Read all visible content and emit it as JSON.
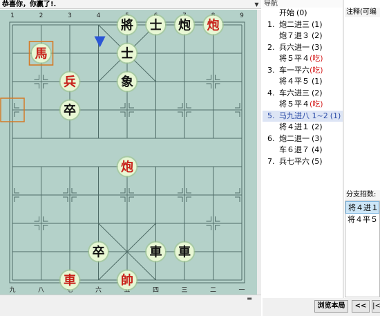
{
  "board": {
    "title": "恭喜你，你赢了!.",
    "dropdown_icon": "▼",
    "top_coords": [
      "1",
      "2",
      "3",
      "4",
      "5",
      "6",
      "7",
      "8",
      "9"
    ],
    "bottom_coords": [
      "九",
      "八",
      "七",
      "六",
      "五",
      "四",
      "三",
      "二",
      "一"
    ],
    "colors": {
      "board_bg": "#b4d1c9",
      "grid_line": "#4e6b66",
      "red_text": "#c8201a",
      "black_text": "#111111",
      "piece_fill": "#e8f7d4",
      "piece_ring": "#9ec48d",
      "marker_orange": "#d47a27",
      "arrow_blue": "#2b56d6"
    },
    "pieces": [
      {
        "char": "將",
        "side": "black",
        "file": 4,
        "rank": 0
      },
      {
        "char": "士",
        "side": "black",
        "file": 5,
        "rank": 0
      },
      {
        "char": "炮",
        "side": "black",
        "file": 6,
        "rank": 0
      },
      {
        "char": "炮",
        "side": "red",
        "file": 7,
        "rank": 0
      },
      {
        "char": "馬",
        "side": "red",
        "file": 1,
        "rank": 1,
        "marked": true
      },
      {
        "char": "士",
        "side": "black",
        "file": 4,
        "rank": 1
      },
      {
        "char": "兵",
        "side": "red",
        "file": 2,
        "rank": 2
      },
      {
        "char": "象",
        "side": "black",
        "file": 4,
        "rank": 2
      },
      {
        "char": "卒",
        "side": "black",
        "file": 2,
        "rank": 3
      },
      {
        "char": "炮",
        "side": "red",
        "file": 4,
        "rank": 5
      },
      {
        "char": "卒",
        "side": "black",
        "file": 3,
        "rank": 8
      },
      {
        "char": "車",
        "side": "black",
        "file": 5,
        "rank": 8
      },
      {
        "char": "車",
        "side": "black",
        "file": 6,
        "rank": 8
      },
      {
        "char": "車",
        "side": "red",
        "file": 2,
        "rank": 9
      },
      {
        "char": "帥",
        "side": "red",
        "file": 4,
        "rank": 9
      }
    ],
    "from_marker": {
      "file": 0,
      "rank": 3
    },
    "last_move_arrow": {
      "file": 3,
      "rank": 0.5
    }
  },
  "navigation": {
    "header": "导航",
    "moves": [
      {
        "num": "",
        "text": "开始",
        "count": "(0)",
        "tag": ""
      },
      {
        "num": "1.",
        "text": "炮二进三",
        "count": "(1)",
        "tag": ""
      },
      {
        "num": "",
        "text": "炮７退３",
        "count": "(2)",
        "tag": ""
      },
      {
        "num": "2.",
        "text": "兵六进一",
        "count": "(3)",
        "tag": ""
      },
      {
        "num": "",
        "text": "将５平４",
        "count": "",
        "tag": "(吃)"
      },
      {
        "num": "3.",
        "text": "车一平六",
        "count": "",
        "tag": "(吃)"
      },
      {
        "num": "",
        "text": "将４平５",
        "count": "(1)",
        "tag": ""
      },
      {
        "num": "4.",
        "text": "车六进三",
        "count": "(2)",
        "tag": ""
      },
      {
        "num": "",
        "text": "将５平４",
        "count": "",
        "tag": "(吃)"
      },
      {
        "num": "5.",
        "text": "马九进八 1~2",
        "count": "(1)",
        "tag": "",
        "selected": true
      },
      {
        "num": "",
        "text": "将４进１",
        "count": "(2)",
        "tag": ""
      },
      {
        "num": "6.",
        "text": "炮二退一",
        "count": "(3)",
        "tag": ""
      },
      {
        "num": "",
        "text": "车６退７",
        "count": "(4)",
        "tag": ""
      },
      {
        "num": "7.",
        "text": "兵七平六",
        "count": "(5)",
        "tag": ""
      }
    ]
  },
  "comment": {
    "header": "注释(可编",
    "text": ""
  },
  "branches": {
    "header": "分支招数:",
    "items": [
      {
        "text": "将４进１",
        "selected": true
      },
      {
        "text": "将４平５",
        "selected": false
      }
    ]
  },
  "controls": {
    "browse_label": "浏览本局",
    "prev_label": "<<",
    "first_label": "|<"
  }
}
